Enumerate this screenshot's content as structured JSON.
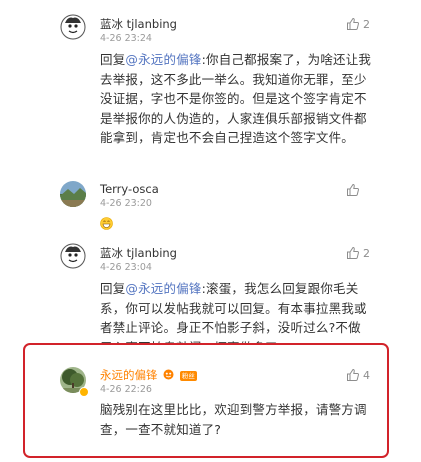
{
  "highlight_color": "#d2232a",
  "mention_color": "#5576c1",
  "comments": [
    {
      "username": "蓝冰 tjlanbing",
      "time": "4-26 23:24",
      "likes": "2",
      "reply_prefix": "回复",
      "mention": "@永远的偏锋",
      "text": ":你自己都报案了，为啥还让我去举报，这不多此一举么。我知道你无罪，至少没证据，字也不是你签的。但是这个签字肯定不是举报你的人伪造的，人家连俱乐部报销文件都能拿到，肯定也不会自己捏造这个签字文件。",
      "avatar_icon": "cartoon-face-icon"
    },
    {
      "username": "Terry-osca",
      "time": "4-26 23:20",
      "likes": "",
      "emoji_icon": "grin-emoji-icon",
      "avatar_icon": "landscape-photo-icon"
    },
    {
      "username": "蓝冰 tjlanbing",
      "time": "4-26 23:04",
      "likes": "2",
      "reply_prefix": "回复",
      "mention": "@永远的偏锋",
      "text": ":滚蛋，我怎么回复跟你毛关系，你可以发帖我就可以回复。有本事拉黑我或者禁止评论。身正不怕影子斜，没听过么?不做亏心事不怕鬼敲门，坏事做多了",
      "avatar_icon": "cartoon-face-icon"
    },
    {
      "username": "永远的偏锋",
      "time": "4-26 22:26",
      "likes": "4",
      "badge_text": "粉丝",
      "text": "脑残别在这里比比，欢迎到警方举报，请警方调查，一查不就知道了?",
      "avatar_icon": "tree-photo-icon"
    }
  ]
}
